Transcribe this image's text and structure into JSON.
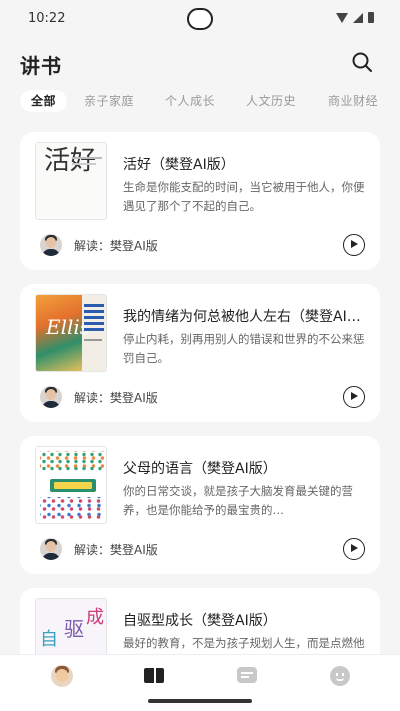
{
  "status_bar": {
    "time": "10:22"
  },
  "header": {
    "title": "讲书"
  },
  "tabs": [
    {
      "label": "全部",
      "active": true
    },
    {
      "label": "亲子家庭",
      "active": false
    },
    {
      "label": "个人成长",
      "active": false
    },
    {
      "label": "人文历史",
      "active": false
    },
    {
      "label": "商业财经",
      "active": false
    }
  ],
  "books": [
    {
      "title": "活好（樊登AI版）",
      "description": "生命是你能支配的时间，当它被用于他人，你便遇见了那个了不起的自己。",
      "cover_text": "活好",
      "reader": "解读：樊登AI版"
    },
    {
      "title": "我的情绪为何总被他人左右（樊登AI版）",
      "description": "停止内耗，别再用别人的错误和世界的不公来惩罚自己。",
      "cover_text": "Ellis",
      "reader": "解读：樊登AI版"
    },
    {
      "title": "父母的语言（樊登AI版）",
      "description": "你的日常交谈，就是孩子大脑发育最关键的营养，也是你能给予的最宝贵的…",
      "cover_text": "",
      "reader": "解读：樊登AI版"
    },
    {
      "title": "自驱型成长（樊登AI版）",
      "description": "最好的教育，不是为孩子规划人生，而是点燃他内在自我发展的动力。",
      "cover_text": "",
      "reader": "解读：樊登AI版"
    }
  ],
  "colors": {
    "background": "#f5f5f5",
    "card": "#ffffff",
    "active_tab": "#222222",
    "inactive_tab": "#9a9a9a"
  }
}
